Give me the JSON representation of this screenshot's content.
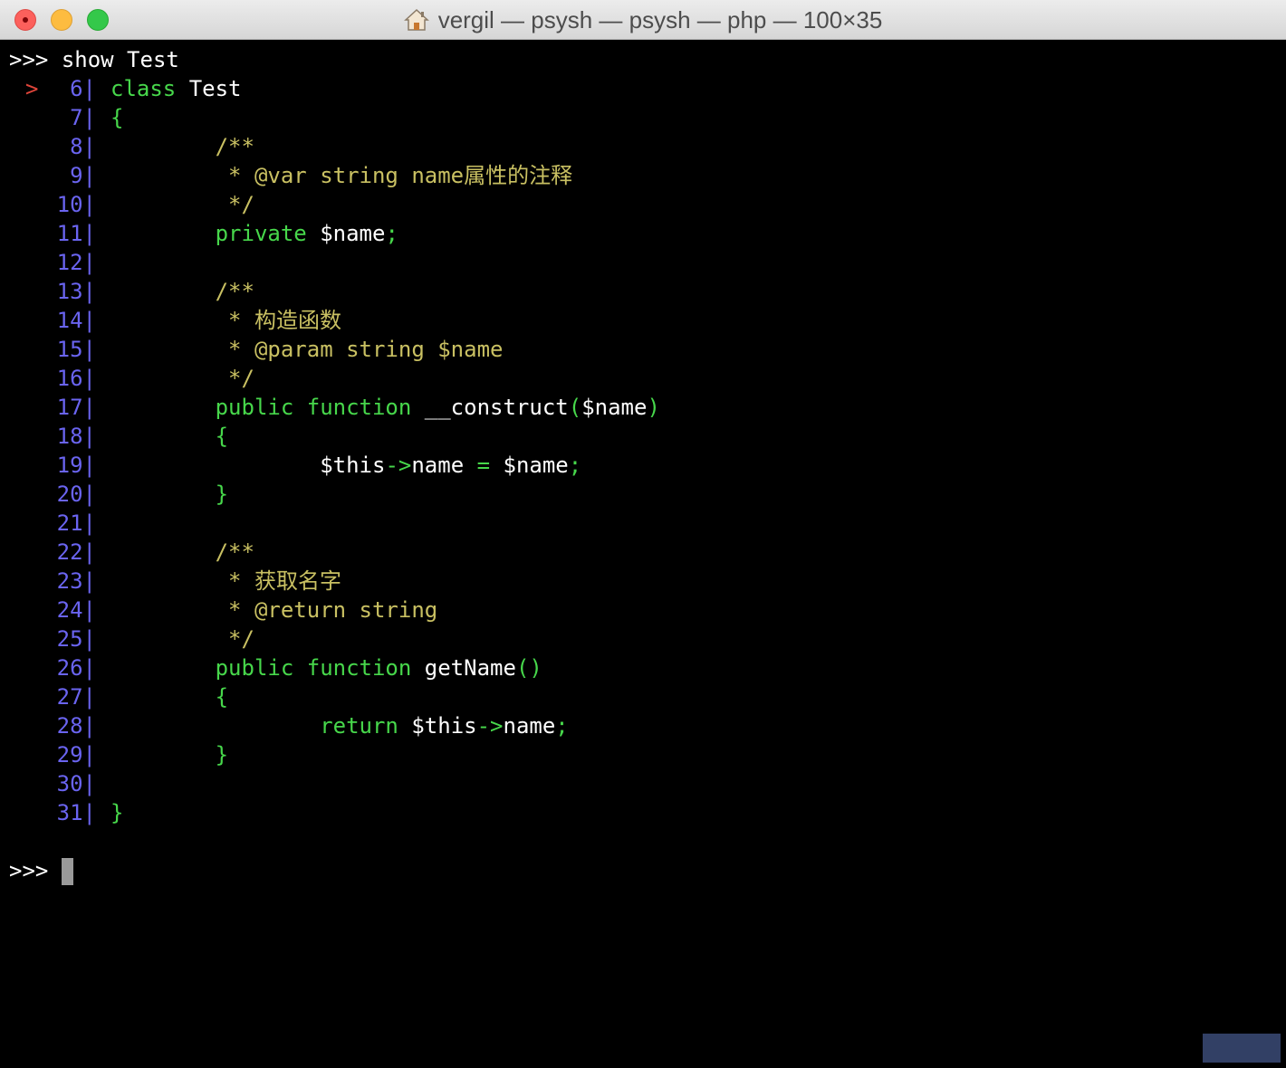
{
  "window": {
    "title": "vergil — psysh — psysh — php — 100×35"
  },
  "prompt": ">>>",
  "command": "show Test",
  "marker": ">",
  "gutter_separator": "|",
  "code_lines": [
    {
      "num": "6",
      "marked": true,
      "tokens": [
        {
          "t": "class ",
          "c": "kw"
        },
        {
          "t": "Test",
          "c": "id"
        }
      ]
    },
    {
      "num": "7",
      "tokens": [
        {
          "t": "{",
          "c": "pun"
        }
      ]
    },
    {
      "num": "8",
      "tokens": [
        {
          "t": "        /**",
          "c": "cm"
        }
      ]
    },
    {
      "num": "9",
      "tokens": [
        {
          "t": "         * @var string name属性的注释",
          "c": "cm"
        }
      ]
    },
    {
      "num": "10",
      "tokens": [
        {
          "t": "         */",
          "c": "cm"
        }
      ]
    },
    {
      "num": "11",
      "tokens": [
        {
          "t": "        private ",
          "c": "kw"
        },
        {
          "t": "$name",
          "c": "id"
        },
        {
          "t": ";",
          "c": "pun"
        }
      ]
    },
    {
      "num": "12",
      "tokens": []
    },
    {
      "num": "13",
      "tokens": [
        {
          "t": "        /**",
          "c": "cm"
        }
      ]
    },
    {
      "num": "14",
      "tokens": [
        {
          "t": "         * 构造函数",
          "c": "cm"
        }
      ]
    },
    {
      "num": "15",
      "tokens": [
        {
          "t": "         * @param string $name",
          "c": "cm"
        }
      ]
    },
    {
      "num": "16",
      "tokens": [
        {
          "t": "         */",
          "c": "cm"
        }
      ]
    },
    {
      "num": "17",
      "tokens": [
        {
          "t": "        public function ",
          "c": "kw"
        },
        {
          "t": "__construct",
          "c": "id"
        },
        {
          "t": "(",
          "c": "pun"
        },
        {
          "t": "$name",
          "c": "id"
        },
        {
          "t": ")",
          "c": "pun"
        }
      ]
    },
    {
      "num": "18",
      "tokens": [
        {
          "t": "        {",
          "c": "pun"
        }
      ]
    },
    {
      "num": "19",
      "tokens": [
        {
          "t": "                ",
          "c": "id"
        },
        {
          "t": "$this",
          "c": "id"
        },
        {
          "t": "->",
          "c": "pun"
        },
        {
          "t": "name ",
          "c": "id"
        },
        {
          "t": "= ",
          "c": "pun"
        },
        {
          "t": "$name",
          "c": "id"
        },
        {
          "t": ";",
          "c": "pun"
        }
      ]
    },
    {
      "num": "20",
      "tokens": [
        {
          "t": "        }",
          "c": "pun"
        }
      ]
    },
    {
      "num": "21",
      "tokens": []
    },
    {
      "num": "22",
      "tokens": [
        {
          "t": "        /**",
          "c": "cm"
        }
      ]
    },
    {
      "num": "23",
      "tokens": [
        {
          "t": "         * 获取名字",
          "c": "cm"
        }
      ]
    },
    {
      "num": "24",
      "tokens": [
        {
          "t": "         * @return string",
          "c": "cm"
        }
      ]
    },
    {
      "num": "25",
      "tokens": [
        {
          "t": "         */",
          "c": "cm"
        }
      ]
    },
    {
      "num": "26",
      "tokens": [
        {
          "t": "        public function ",
          "c": "kw"
        },
        {
          "t": "getName",
          "c": "id"
        },
        {
          "t": "()",
          "c": "pun"
        }
      ]
    },
    {
      "num": "27",
      "tokens": [
        {
          "t": "        {",
          "c": "pun"
        }
      ]
    },
    {
      "num": "28",
      "tokens": [
        {
          "t": "                return ",
          "c": "kw"
        },
        {
          "t": "$this",
          "c": "id"
        },
        {
          "t": "->",
          "c": "pun"
        },
        {
          "t": "name",
          "c": "id"
        },
        {
          "t": ";",
          "c": "pun"
        }
      ]
    },
    {
      "num": "29",
      "tokens": [
        {
          "t": "        }",
          "c": "pun"
        }
      ]
    },
    {
      "num": "30",
      "tokens": []
    },
    {
      "num": "31",
      "tokens": [
        {
          "t": "}",
          "c": "pun"
        }
      ]
    }
  ],
  "colors": {
    "keyword": "#47d74b",
    "comment": "#c9c062",
    "line_number": "#6a64f0",
    "marker": "#e0453a",
    "text": "#ffffff",
    "background": "#000000"
  }
}
